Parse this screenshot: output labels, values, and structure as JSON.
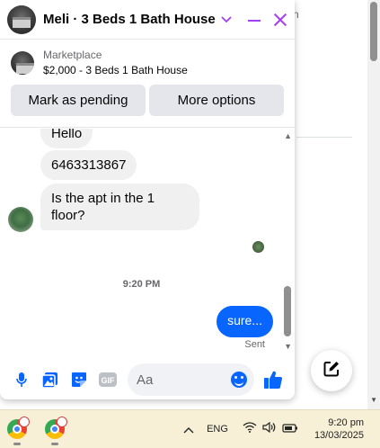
{
  "background": {
    "partial_text": "n"
  },
  "chat": {
    "title": "Meli · 3 Beds 1 Bath House",
    "listing": {
      "label": "Marketplace",
      "title": "$2,000 - 3 Beds 1 Bath House"
    },
    "buttons": {
      "mark_pending": "Mark as pending",
      "more_options": "More options"
    },
    "messages": [
      {
        "direction": "in",
        "text": "Hello"
      },
      {
        "direction": "in",
        "text": "6463313867"
      },
      {
        "direction": "in",
        "text": "Is the apt in the 1 floor?"
      },
      {
        "direction": "out",
        "text": "sure..."
      }
    ],
    "timestamp": "9:20 PM",
    "status": "Sent",
    "composer": {
      "placeholder": "Aa"
    },
    "colors": {
      "accent": "#a33ff4",
      "outgoing_bubble": "#0866ff",
      "incoming_bubble": "#f0f0f0"
    }
  },
  "icons": {
    "composer": [
      "microphone-icon",
      "image-icon",
      "sticker-icon",
      "gif-icon",
      "emoji-icon",
      "like-icon"
    ],
    "header": [
      "chevron-down-icon",
      "minimize-icon",
      "close-icon"
    ],
    "floating": "compose-icon"
  },
  "taskbar": {
    "language": "ENG",
    "time": "9:20 pm",
    "date": "13/03/2025"
  }
}
